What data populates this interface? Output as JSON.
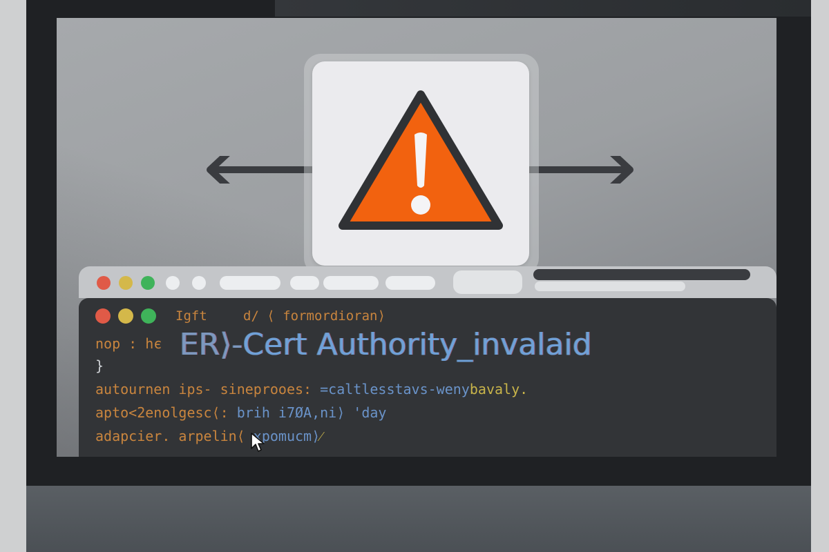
{
  "colors": {
    "warning_orange": "#f2620f",
    "dot_red": "#e05a47",
    "dot_yellow": "#d4b84a",
    "dot_green": "#3fb35a"
  },
  "icons": [
    "arrow-left-icon",
    "arrow-right-icon",
    "warning-triangle-icon",
    "mouse-cursor-icon"
  ],
  "terminal": {
    "title_left": "Igft",
    "title_right": "d/ ⟨ formordioran⟩",
    "prefix": "nop : hє",
    "headline_prefix": "ER⟩-",
    "headline_main": "Cert Authority_invalaid",
    "brace": "}",
    "line1_a": "autournen ips- sineproоes: ",
    "line1_b": "=caltlesstavs-weny",
    "line1_c": "bavaly.",
    "line2_a": "apto<2enolgesc⟨: ",
    "line2_b": "brih i7ØA,ni⟩ ",
    "line2_c": "'day",
    "line3_a": "adapcier. arpelin⟨ ",
    "line3_b": "xpomucm⟩",
    "line3_c": "⁄"
  }
}
